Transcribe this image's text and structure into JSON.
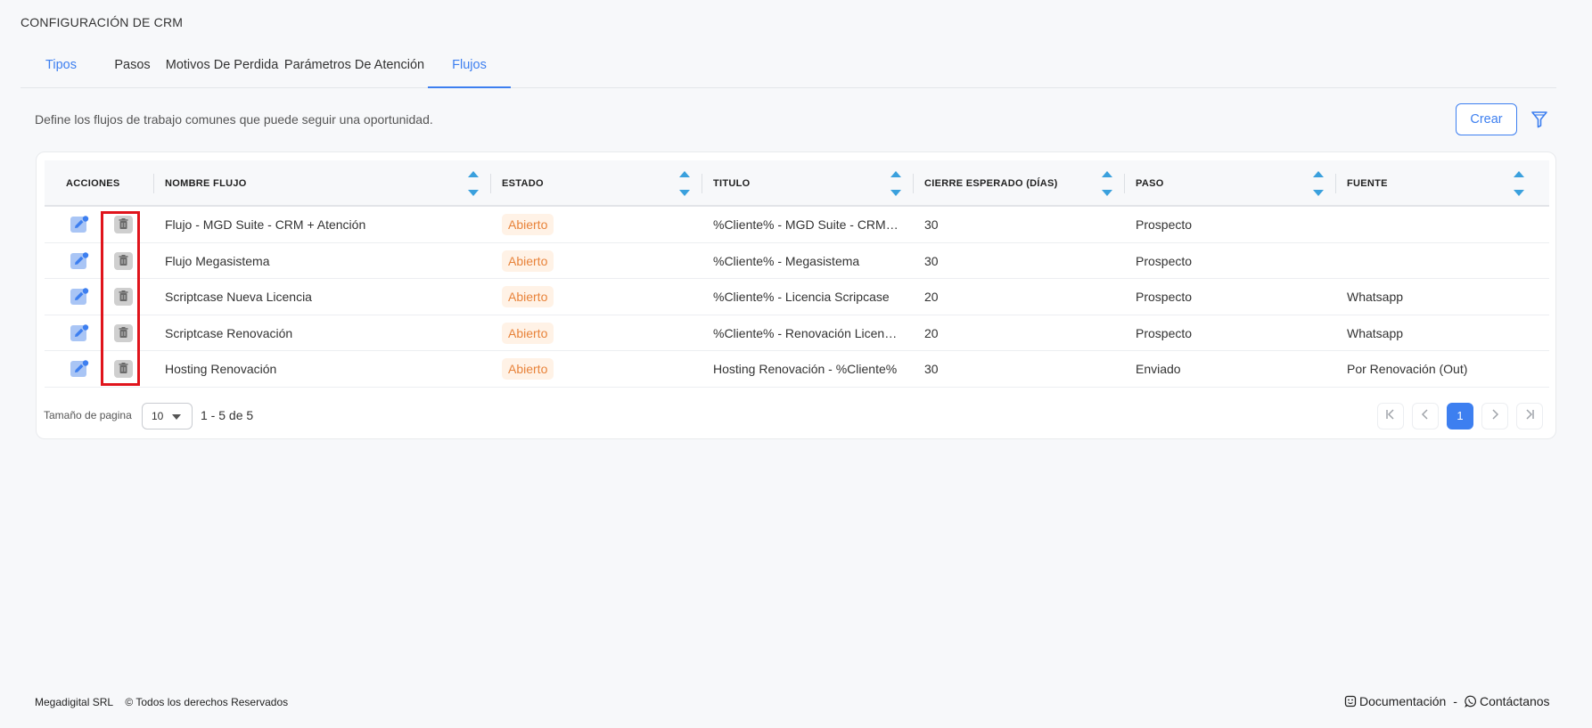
{
  "page": {
    "title": "CONFIGURACIÓN DE CRM"
  },
  "tabs": [
    {
      "label": "Tipos",
      "active": false
    },
    {
      "label": "Pasos",
      "active": false
    },
    {
      "label": "Motivos De Perdida",
      "active": false
    },
    {
      "label": "Parámetros De Atención",
      "active": false
    },
    {
      "label": "Flujos",
      "active": true
    }
  ],
  "section": {
    "description": "Define los flujos de trabajo comunes que puede seguir una oportunidad.",
    "create_label": "Crear",
    "filter_icon": "filter-icon"
  },
  "grid": {
    "columns": [
      "ACCIONES",
      "NOMBRE FLUJO",
      "ESTADO",
      "TITULO",
      "CIERRE ESPERADO (DÍAS)",
      "PASO",
      "FUENTE"
    ],
    "rows": [
      {
        "nombre": "Flujo - MGD Suite - CRM + Atención",
        "estado": "Abierto",
        "titulo": "%Cliente% - MGD Suite - CRM + Atención",
        "cierre": "30",
        "paso": "Prospecto",
        "fuente": ""
      },
      {
        "nombre": "Flujo Megasistema",
        "estado": "Abierto",
        "titulo": "%Cliente% - Megasistema",
        "cierre": "30",
        "paso": "Prospecto",
        "fuente": ""
      },
      {
        "nombre": "Scriptcase Nueva Licencia",
        "estado": "Abierto",
        "titulo": "%Cliente% - Licencia Scripcase",
        "cierre": "20",
        "paso": "Prospecto",
        "fuente": "Whatsapp"
      },
      {
        "nombre": "Scriptcase Renovación",
        "estado": "Abierto",
        "titulo": "%Cliente% - Renovación Licencia Scriptcase",
        "cierre": "20",
        "paso": "Prospecto",
        "fuente": "Whatsapp"
      },
      {
        "nombre": "Hosting Renovación",
        "estado": "Abierto",
        "titulo": "Hosting Renovación - %Cliente%",
        "cierre": "30",
        "paso": "Enviado",
        "fuente": "Por Renovación (Out)"
      }
    ],
    "row_icons": {
      "edit": "edit-icon",
      "delete": "trash-icon"
    },
    "status_color": "#e8833a",
    "accent_color": "#3d7ff0"
  },
  "pagination": {
    "page_size_label": "Tamaño de pagina",
    "page_size": "10",
    "range_text": "1 - 5 de 5",
    "current_page": "1",
    "icons": [
      "first-page-icon",
      "prev-page-icon",
      "next-page-icon",
      "last-page-icon"
    ]
  },
  "footer": {
    "company": "Megadigital SRL",
    "rights": "© Todos los derechos Reservados",
    "docs_label": "Documentación",
    "separator": "-",
    "contact_label": "Contáctanos"
  }
}
